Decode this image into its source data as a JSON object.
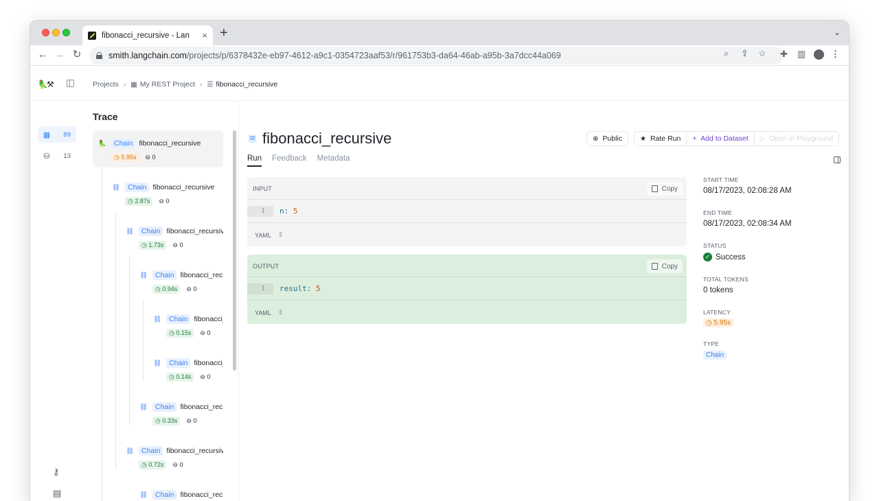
{
  "browser": {
    "tab_title": "fibonacci_recursive - LangSmith",
    "new_tab": "+",
    "url_host": "smith.langchain.com",
    "url_path": "/projects/p/6378432e-eb97-4612-a9c1-0354723aaf53/r/961753b3-da64-46ab-a95b-3a7dcc44a069"
  },
  "breadcrumb": {
    "projects": "Projects",
    "project": "My REST Project",
    "run": "fibonacci_recursive"
  },
  "leftnav": [
    {
      "icon": "grid-icon",
      "count": "89",
      "active": true
    },
    {
      "icon": "database-icon",
      "count": "13",
      "active": false
    }
  ],
  "trace": {
    "title": "Trace",
    "nodes": [
      {
        "type": "Chain",
        "name": "fibonacci_recursive",
        "latency": "5.95s",
        "tokens": "0"
      },
      {
        "type": "Chain",
        "name": "fibonacci_recursive",
        "latency": "2.87s",
        "tokens": "0"
      },
      {
        "type": "Chain",
        "name": "fibonacci_recursive",
        "latency": "1.73s",
        "tokens": "0"
      },
      {
        "type": "Chain",
        "name": "fibonacci_recursive",
        "latency": "0.94s",
        "tokens": "0"
      },
      {
        "type": "Chain",
        "name": "fibonacci_recursive",
        "latency": "0.15s",
        "tokens": "0"
      },
      {
        "type": "Chain",
        "name": "fibonacci_recursive",
        "latency": "0.14s",
        "tokens": "0"
      },
      {
        "type": "Chain",
        "name": "fibonacci_recursive",
        "latency": "0.33s",
        "tokens": "0"
      },
      {
        "type": "Chain",
        "name": "fibonacci_recursive",
        "latency": "0.72s",
        "tokens": "0"
      },
      {
        "type": "Chain",
        "name": "fibonacci_recursive",
        "latency": "",
        "tokens": ""
      }
    ]
  },
  "run": {
    "title": "fibonacci_recursive",
    "actions": {
      "public": "Public",
      "rate": "Rate Run",
      "add_dataset": "Add to Dataset",
      "playground": "Open in Playground"
    },
    "tabs": [
      "Run",
      "Feedback",
      "Metadata"
    ],
    "input": {
      "label": "INPUT",
      "copy": "Copy",
      "line_no": "1",
      "key": "n:",
      "value": "5",
      "format": "YAML"
    },
    "output": {
      "label": "OUTPUT",
      "copy": "Copy",
      "line_no": "1",
      "key": "result:",
      "value": "5",
      "format": "YAML"
    }
  },
  "meta": {
    "start_time_label": "START TIME",
    "start_time": "08/17/2023, 02:08:28 AM",
    "end_time_label": "END TIME",
    "end_time": "08/17/2023, 02:08:34 AM",
    "status_label": "STATUS",
    "status": "Success",
    "tokens_label": "TOTAL TOKENS",
    "tokens": "0 tokens",
    "latency_label": "LATENCY",
    "latency": "5.95s",
    "type_label": "TYPE",
    "type": "Chain"
  },
  "colors": {
    "accent_blue": "#3b82f6",
    "success_green": "#1a7f37",
    "latency_orange": "#d97706",
    "purple": "#6d45c8"
  }
}
